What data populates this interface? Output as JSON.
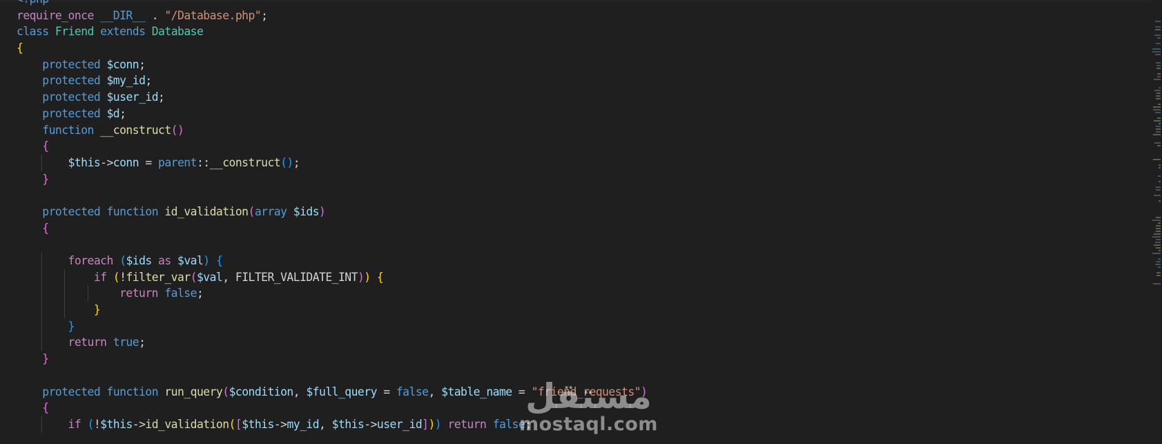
{
  "editor": {
    "language": "php",
    "theme_colors": {
      "background": "#1f1f1f",
      "keyword": "#569cd6",
      "control": "#c586c0",
      "variable": "#9cdcfe",
      "function": "#dcdcaa",
      "string": "#ce9178",
      "class": "#4ec9b0",
      "bracket_1": "#ffd700",
      "bracket_2": "#da70d6",
      "bracket_3": "#179fff"
    },
    "lines": [
      {
        "indent": 0,
        "tokens": [
          [
            "k",
            "<?php"
          ]
        ]
      },
      {
        "indent": 0,
        "tokens": [
          [
            "c",
            "require_once"
          ],
          [
            "p",
            " "
          ],
          [
            "k",
            "__DIR__"
          ],
          [
            "p",
            " . "
          ],
          [
            "s",
            "\"/Database.php\""
          ],
          [
            "p",
            ";"
          ]
        ]
      },
      {
        "indent": 0,
        "tokens": [
          [
            "k",
            "class"
          ],
          [
            "p",
            " "
          ],
          [
            "t",
            "Friend"
          ],
          [
            "p",
            " "
          ],
          [
            "k",
            "extends"
          ],
          [
            "p",
            " "
          ],
          [
            "t",
            "Database"
          ]
        ]
      },
      {
        "indent": 0,
        "tokens": [
          [
            "c1",
            "{"
          ]
        ]
      },
      {
        "indent": 1,
        "tokens": [
          [
            "k",
            "protected"
          ],
          [
            "p",
            " "
          ],
          [
            "v",
            "$conn"
          ],
          [
            "p",
            ";"
          ]
        ]
      },
      {
        "indent": 1,
        "tokens": [
          [
            "k",
            "protected"
          ],
          [
            "p",
            " "
          ],
          [
            "v",
            "$my_id"
          ],
          [
            "p",
            ";"
          ]
        ]
      },
      {
        "indent": 1,
        "tokens": [
          [
            "k",
            "protected"
          ],
          [
            "p",
            " "
          ],
          [
            "v",
            "$user_id"
          ],
          [
            "p",
            ";"
          ]
        ]
      },
      {
        "indent": 1,
        "tokens": [
          [
            "k",
            "protected"
          ],
          [
            "p",
            " "
          ],
          [
            "v",
            "$d"
          ],
          [
            "p",
            ";"
          ]
        ]
      },
      {
        "indent": 1,
        "tokens": [
          [
            "k",
            "function"
          ],
          [
            "p",
            " "
          ],
          [
            "f",
            "__construct"
          ],
          [
            "c2",
            "()"
          ]
        ]
      },
      {
        "indent": 1,
        "tokens": [
          [
            "c2",
            "{"
          ]
        ]
      },
      {
        "indent": 2,
        "tokens": [
          [
            "v",
            "$this"
          ],
          [
            "p",
            "->"
          ],
          [
            "v",
            "conn"
          ],
          [
            "p",
            " = "
          ],
          [
            "k",
            "parent"
          ],
          [
            "p",
            "::"
          ],
          [
            "f",
            "__construct"
          ],
          [
            "c3",
            "()"
          ],
          [
            "p",
            ";"
          ]
        ]
      },
      {
        "indent": 1,
        "tokens": [
          [
            "c2",
            "}"
          ]
        ]
      },
      {
        "indent": 0,
        "tokens": []
      },
      {
        "indent": 1,
        "tokens": [
          [
            "k",
            "protected"
          ],
          [
            "p",
            " "
          ],
          [
            "k",
            "function"
          ],
          [
            "p",
            " "
          ],
          [
            "f",
            "id_validation"
          ],
          [
            "c2",
            "("
          ],
          [
            "k",
            "array"
          ],
          [
            "p",
            " "
          ],
          [
            "v",
            "$ids"
          ],
          [
            "c2",
            ")"
          ]
        ]
      },
      {
        "indent": 1,
        "tokens": [
          [
            "c2",
            "{"
          ]
        ]
      },
      {
        "indent": 0,
        "tokens": []
      },
      {
        "indent": 2,
        "tokens": [
          [
            "c",
            "foreach"
          ],
          [
            "p",
            " "
          ],
          [
            "c3",
            "("
          ],
          [
            "v",
            "$ids"
          ],
          [
            "p",
            " "
          ],
          [
            "c",
            "as"
          ],
          [
            "p",
            " "
          ],
          [
            "v",
            "$val"
          ],
          [
            "c3",
            ")"
          ],
          [
            "p",
            " "
          ],
          [
            "c3",
            "{"
          ]
        ]
      },
      {
        "indent": 3,
        "tokens": [
          [
            "c",
            "if"
          ],
          [
            "p",
            " "
          ],
          [
            "c1",
            "("
          ],
          [
            "p",
            "!"
          ],
          [
            "f",
            "filter_var"
          ],
          [
            "c2",
            "("
          ],
          [
            "v",
            "$val"
          ],
          [
            "p",
            ", "
          ],
          [
            "p",
            "FILTER_VALIDATE_INT"
          ],
          [
            "c2",
            ")"
          ],
          [
            "c1",
            ")"
          ],
          [
            "p",
            " "
          ],
          [
            "c1",
            "{"
          ]
        ]
      },
      {
        "indent": 4,
        "tokens": [
          [
            "c",
            "return"
          ],
          [
            "p",
            " "
          ],
          [
            "k",
            "false"
          ],
          [
            "p",
            ";"
          ]
        ]
      },
      {
        "indent": 3,
        "tokens": [
          [
            "c1",
            "}"
          ]
        ]
      },
      {
        "indent": 2,
        "tokens": [
          [
            "c3",
            "}"
          ]
        ]
      },
      {
        "indent": 2,
        "tokens": [
          [
            "c",
            "return"
          ],
          [
            "p",
            " "
          ],
          [
            "k",
            "true"
          ],
          [
            "p",
            ";"
          ]
        ]
      },
      {
        "indent": 1,
        "tokens": [
          [
            "c2",
            "}"
          ]
        ]
      },
      {
        "indent": 0,
        "tokens": []
      },
      {
        "indent": 1,
        "tokens": [
          [
            "k",
            "protected"
          ],
          [
            "p",
            " "
          ],
          [
            "k",
            "function"
          ],
          [
            "p",
            " "
          ],
          [
            "f",
            "run_query"
          ],
          [
            "c2",
            "("
          ],
          [
            "v",
            "$condition"
          ],
          [
            "p",
            ", "
          ],
          [
            "v",
            "$full_query"
          ],
          [
            "p",
            " = "
          ],
          [
            "k",
            "false"
          ],
          [
            "p",
            ", "
          ],
          [
            "v",
            "$table_name"
          ],
          [
            "p",
            " = "
          ],
          [
            "s",
            "\"friend_requests\""
          ],
          [
            "c2",
            ")"
          ]
        ]
      },
      {
        "indent": 1,
        "tokens": [
          [
            "c2",
            "{"
          ]
        ]
      },
      {
        "indent": 2,
        "tokens": [
          [
            "c",
            "if"
          ],
          [
            "p",
            " "
          ],
          [
            "c3",
            "("
          ],
          [
            "p",
            "!"
          ],
          [
            "v",
            "$this"
          ],
          [
            "p",
            "->"
          ],
          [
            "f",
            "id_validation"
          ],
          [
            "c1",
            "("
          ],
          [
            "c2",
            "["
          ],
          [
            "v",
            "$this"
          ],
          [
            "p",
            "->"
          ],
          [
            "v",
            "my_id"
          ],
          [
            "p",
            ", "
          ],
          [
            "v",
            "$this"
          ],
          [
            "p",
            "->"
          ],
          [
            "v",
            "user_id"
          ],
          [
            "c2",
            "]"
          ],
          [
            "c1",
            ")"
          ],
          [
            "c3",
            ")"
          ],
          [
            "p",
            " "
          ],
          [
            "c",
            "return"
          ],
          [
            "p",
            " "
          ],
          [
            "k",
            "false"
          ],
          [
            "p",
            ";"
          ]
        ]
      }
    ]
  },
  "watermark": {
    "arabic": "مستقل",
    "latin": "mostaql.com"
  }
}
